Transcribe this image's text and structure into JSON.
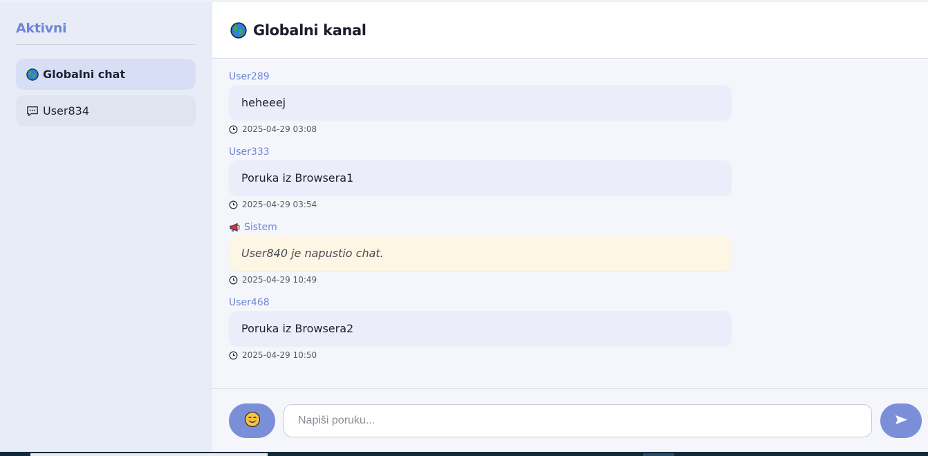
{
  "sidebar": {
    "title": "Aktivni",
    "channels": [
      {
        "label": "Globalni chat",
        "icon": "globe-icon",
        "active": true
      },
      {
        "label": "User834",
        "icon": "speech-bubble-icon",
        "active": false
      }
    ]
  },
  "header": {
    "icon": "globe-icon",
    "title": "Globalni kanal"
  },
  "messages": [
    {
      "sender": "User289",
      "text": "heheeej",
      "time": "2025-04-29 03:08",
      "system": false
    },
    {
      "sender": "User333",
      "text": "Poruka iz Browsera1",
      "time": "2025-04-29 03:54",
      "system": false
    },
    {
      "sender": "Sistem",
      "text": "User840 je napustio chat.",
      "time": "2025-04-29 10:49",
      "system": true,
      "icon": "megaphone-icon"
    },
    {
      "sender": "User468",
      "text": "Poruka iz Browsera2",
      "time": "2025-04-29 10:50",
      "system": false
    }
  ],
  "composer": {
    "emoji_icon": "smiley-icon",
    "placeholder": "Napiši poruku...",
    "send_icon": "send-arrow-icon"
  },
  "colors": {
    "accent": "#7b8fd9",
    "sender": "#6f86d6",
    "bubble": "#ebeefa",
    "system_bubble": "#fdf6e4"
  }
}
